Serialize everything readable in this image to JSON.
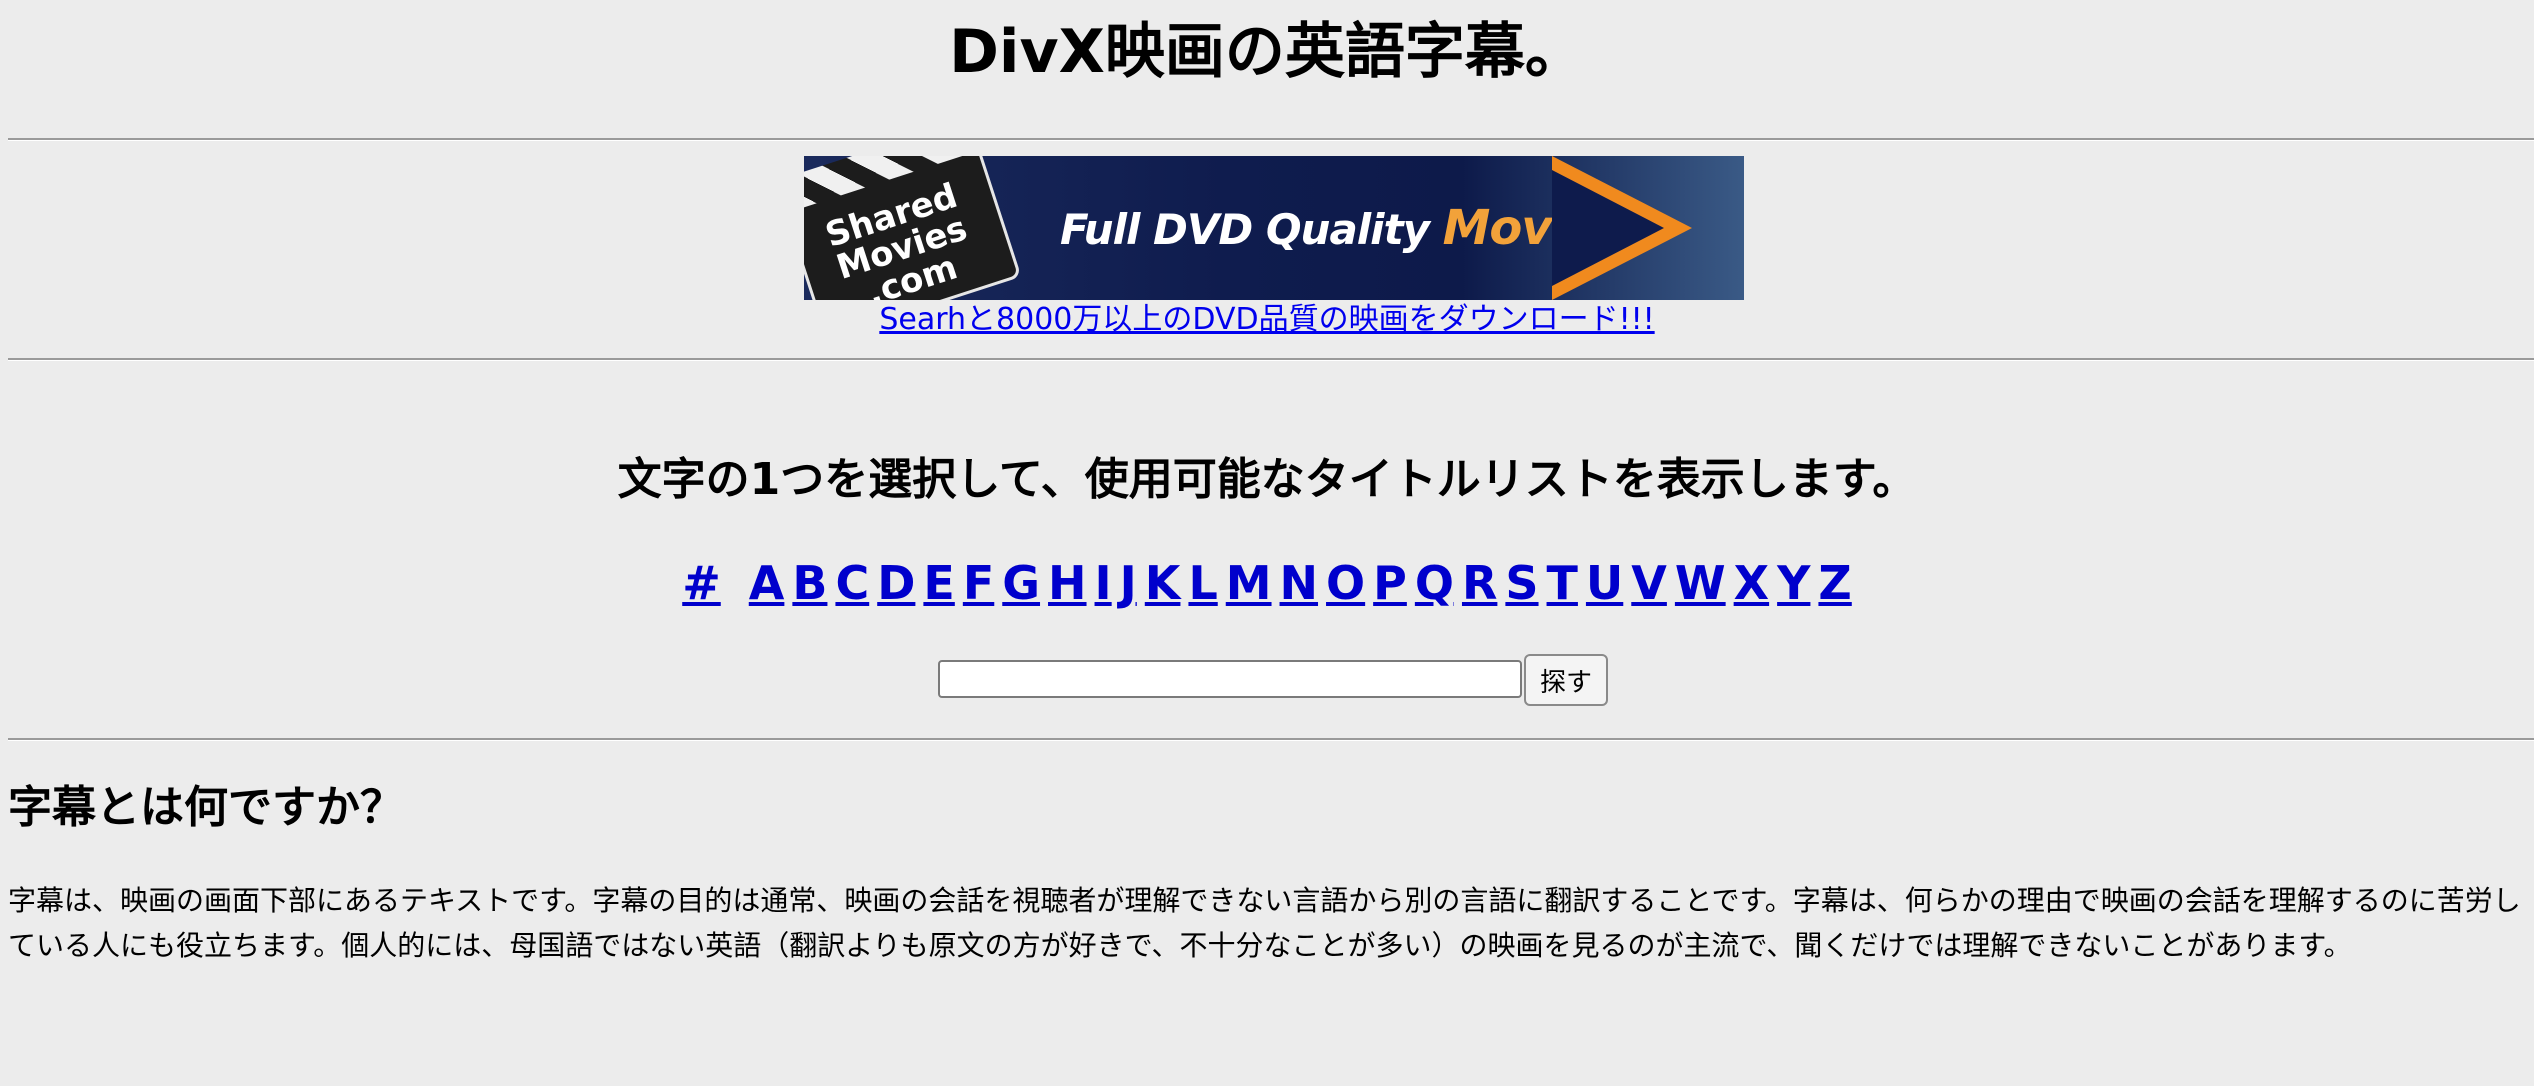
{
  "header": {
    "title": "DivX映画の英語字幕。"
  },
  "banner": {
    "logo_text": "Shared Movies .com",
    "tagline_main": "Full DVD Quality ",
    "tagline_accent": "Movies!",
    "colors": {
      "background": "#0f1c4e",
      "accent": "#f08a1e"
    },
    "link_text": "Searhと8000万以上のDVD品質の映画をダウンロード!!!"
  },
  "browse": {
    "heading": "文字の1つを選択して、使用可能なタイトルリストを表示します。",
    "hash_label": "#",
    "letters": [
      "A",
      "B",
      "C",
      "D",
      "E",
      "F",
      "G",
      "H",
      "I",
      "J",
      "K",
      "L",
      "M",
      "N",
      "O",
      "P",
      "Q",
      "R",
      "S",
      "T",
      "U",
      "V",
      "W",
      "X",
      "Y",
      "Z"
    ]
  },
  "search": {
    "input_value": "",
    "button_label": "探す"
  },
  "about": {
    "heading": "字幕とは何ですか？",
    "body": "字幕は、映画の画面下部にあるテキストです。字幕の目的は通常、映画の会話を視聴者が理解できない言語から別の言語に翻訳することです。字幕は、何らかの理由で映画の会話を理解するのに苦労している人にも役立ちます。個人的には、母国語ではない英語（翻訳よりも原文の方が好きで、不十分なことが多い）の映画を見るのが主流で、聞くだけでは理解できないことがあります。"
  }
}
